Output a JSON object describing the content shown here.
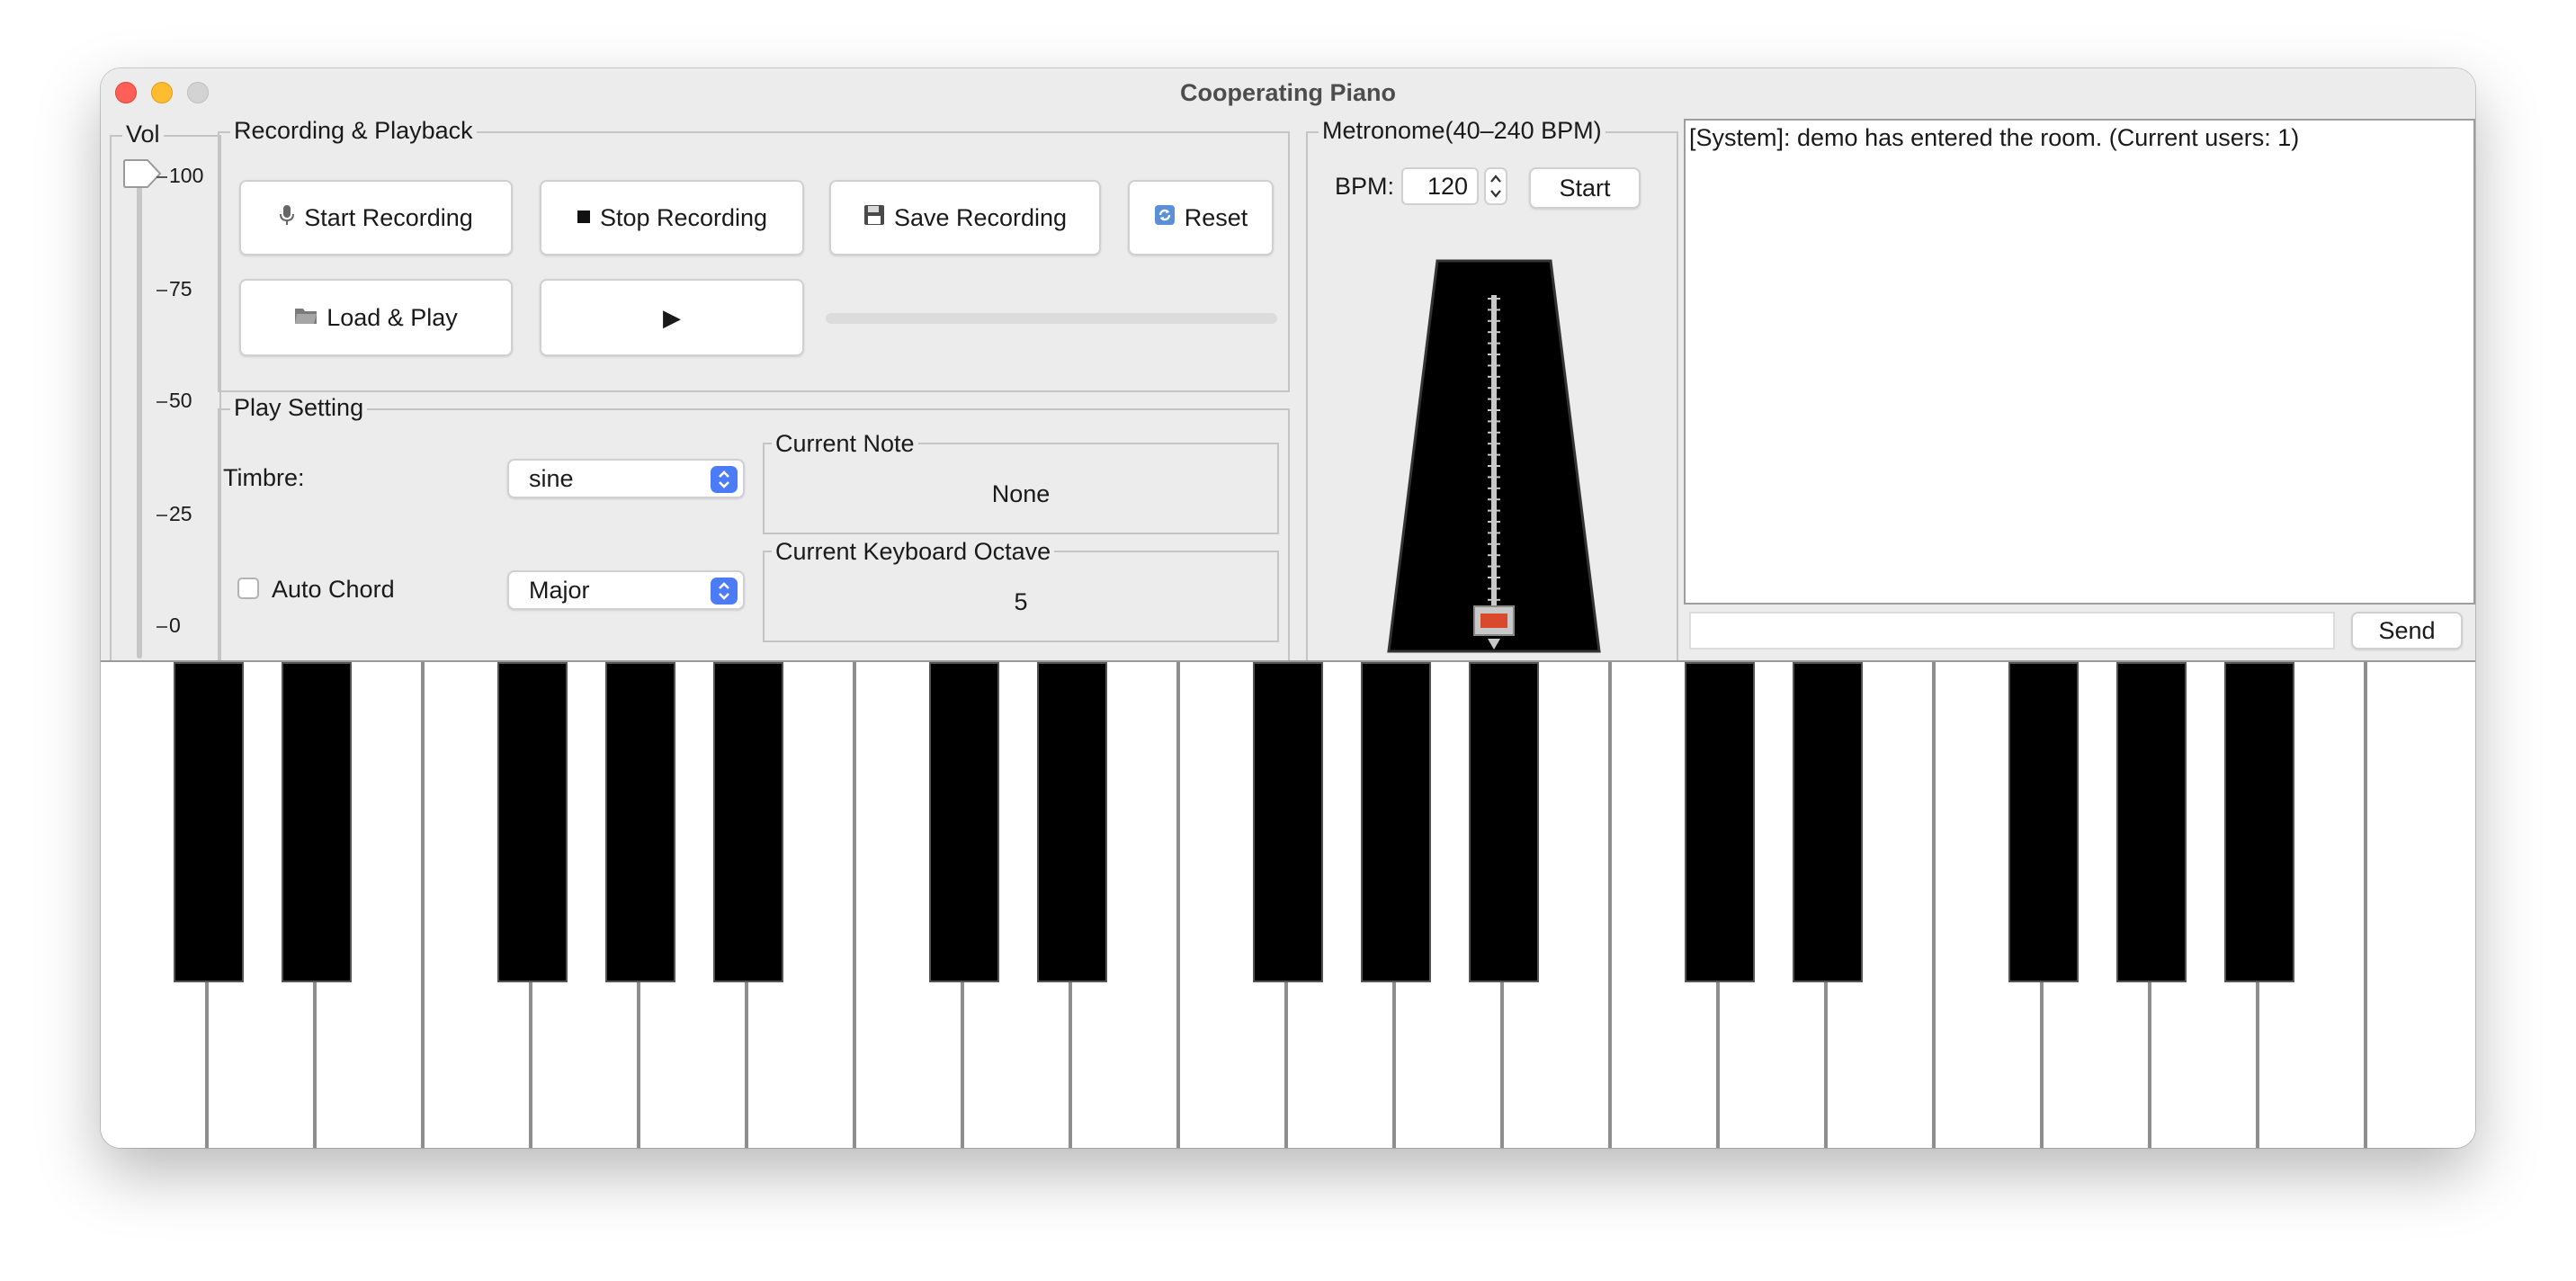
{
  "window": {
    "title": "Cooperating Piano"
  },
  "volume": {
    "group_title": "Vol",
    "value": 100,
    "ticks": [
      "100",
      "75",
      "50",
      "25",
      "0"
    ]
  },
  "recording": {
    "group_title": "Recording & Playback",
    "start_label": "Start Recording",
    "stop_label": "Stop Recording",
    "save_label": "Save Recording",
    "reset_label": "Reset",
    "load_label": "Load & Play",
    "play_glyph": "▶",
    "progress": 0,
    "icons": {
      "start": "microphone-icon",
      "stop": "stop-square-icon",
      "save": "floppy-disk-icon",
      "reset": "refresh-icon",
      "load": "folder-icon",
      "play": "play-icon"
    }
  },
  "play_setting": {
    "group_title": "Play Setting",
    "timbre_label": "Timbre:",
    "timbre_value": "sine",
    "auto_chord_label": "Auto Chord",
    "auto_chord_checked": false,
    "chord_value": "Major",
    "current_note_title": "Current Note",
    "current_note_value": "None",
    "octave_title": "Current Keyboard Octave",
    "octave_value": "5"
  },
  "metronome": {
    "group_title": "Metronome(40–240 BPM)",
    "bpm_label": "BPM:",
    "bpm_value": "120",
    "start_label": "Start",
    "body_color": "#000000",
    "weight_color": "#d84a2b"
  },
  "chat": {
    "messages": [
      "[System]: demo has entered the room. (Current users: 1)"
    ],
    "input_value": "",
    "send_label": "Send"
  },
  "piano": {
    "white_key_count": 22,
    "black_key_pattern": [
      1,
      1,
      0,
      1,
      1,
      1,
      0
    ]
  }
}
